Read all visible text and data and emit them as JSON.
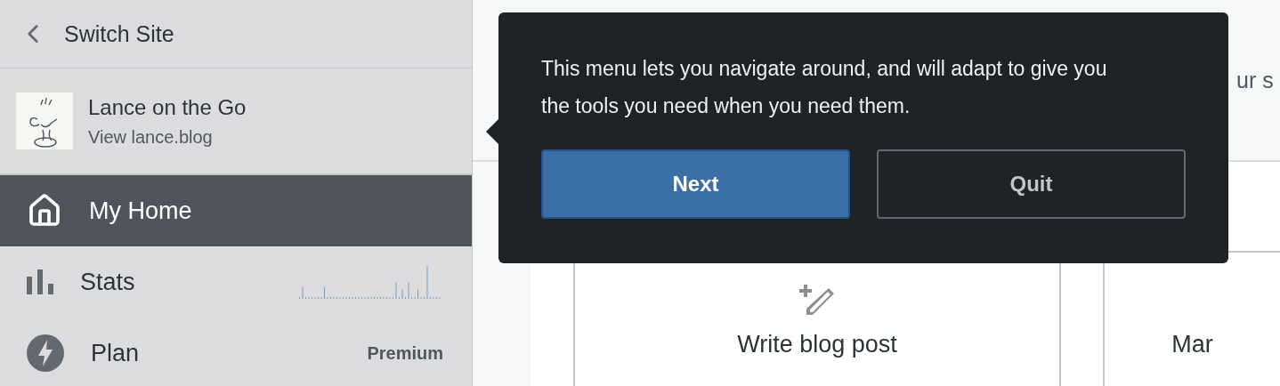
{
  "header": {
    "back_label": "Switch Site"
  },
  "site": {
    "name": "Lance on the Go",
    "url_label": "View lance.blog"
  },
  "nav": [
    {
      "kind": "home",
      "label": "My Home",
      "selected": true
    },
    {
      "kind": "stats",
      "label": "Stats",
      "selected": false
    },
    {
      "kind": "plan",
      "label": "Plan",
      "badge": "Premium",
      "selected": false
    }
  ],
  "main": {
    "header_text": "ur s",
    "cards": [
      {
        "kind": "write",
        "label": "Write blog post"
      },
      {
        "kind": "more",
        "label": "Mar"
      }
    ]
  },
  "tooltip": {
    "text": "This menu lets you navigate around, and will adapt to give you the tools you need when you need them.",
    "buttons": [
      {
        "label": "Next",
        "kind": "primary"
      },
      {
        "label": "Quit",
        "kind": "secondary"
      }
    ]
  }
}
